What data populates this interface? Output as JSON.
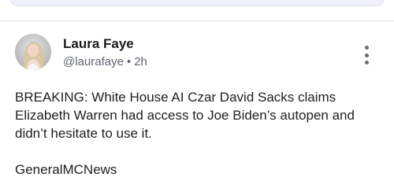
{
  "post": {
    "author_name": "Laura Faye",
    "handle": "@laurafaye",
    "separator": "•",
    "time": "2h",
    "avatar_icon": "profile-photo",
    "more_icon": "vertical-ellipsis-icon",
    "body": "BREAKING: White House AI Czar David Sacks claims Elizabeth Warren had access to Joe Biden’s autopen and didn’t hesitate to use it.",
    "footer": "GeneralMCNews"
  }
}
